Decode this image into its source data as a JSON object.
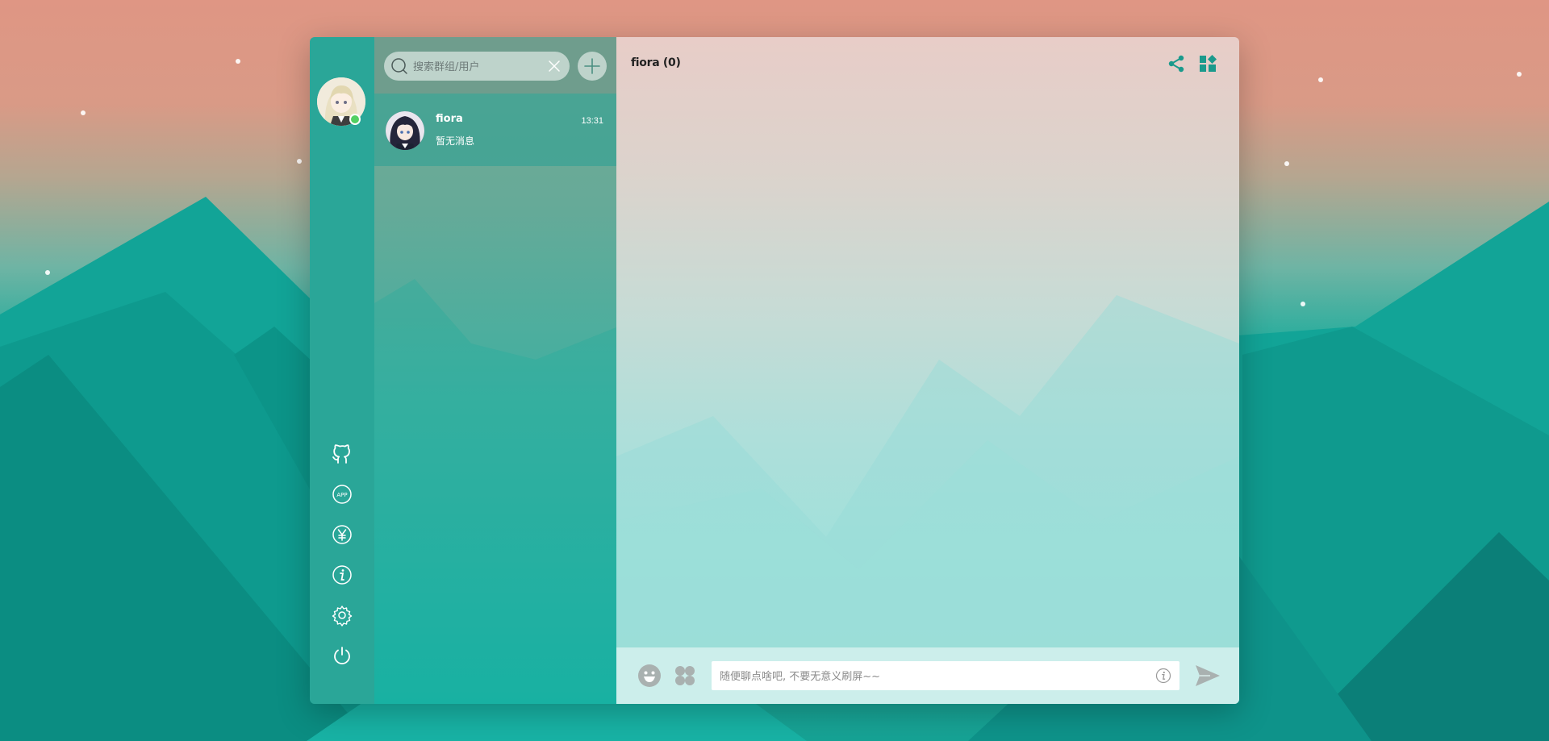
{
  "search": {
    "placeholder": "搜索群组/用户"
  },
  "conversations": [
    {
      "name": "fiora",
      "time": "13:31",
      "preview": "暂无消息"
    }
  ],
  "chat": {
    "title": "fiora (0)"
  },
  "composer": {
    "placeholder": "随便聊点啥吧, 不要无意义刷屏~~"
  },
  "sidebar_icons": [
    "github-icon",
    "app-icon",
    "yen-icon",
    "info-icon",
    "gear-icon",
    "power-icon"
  ],
  "header_icons": [
    "share-icon",
    "widgets-icon"
  ],
  "composer_icons": [
    "emoji-icon",
    "function-icon",
    "info-icon",
    "send-icon"
  ],
  "colors": {
    "accent": "#2aa698",
    "icon_teal": "#1a9a8c",
    "online": "#52d063"
  }
}
